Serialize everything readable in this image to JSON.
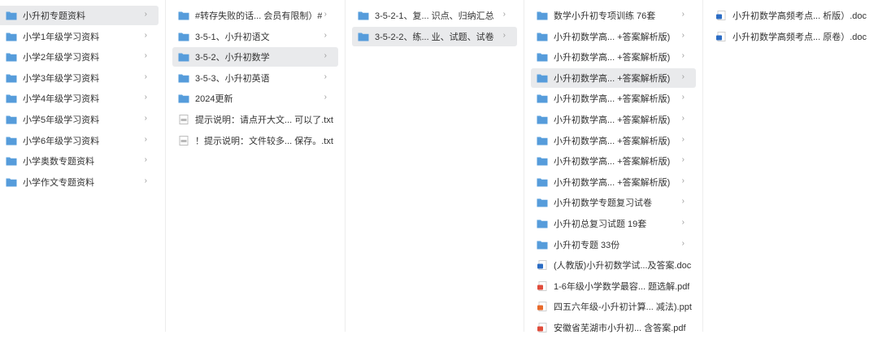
{
  "columns": [
    {
      "items": [
        {
          "type": "folder",
          "label": "小升初专题资料",
          "selected": true
        },
        {
          "type": "folder",
          "label": "小学1年级学习资料"
        },
        {
          "type": "folder",
          "label": "小学2年级学习资料"
        },
        {
          "type": "folder",
          "label": "小学3年级学习资料"
        },
        {
          "type": "folder",
          "label": "小学4年级学习资料"
        },
        {
          "type": "folder",
          "label": "小学5年级学习资料"
        },
        {
          "type": "folder",
          "label": "小学6年级学习资料"
        },
        {
          "type": "folder",
          "label": "小学奥数专题资料"
        },
        {
          "type": "folder",
          "label": "小学作文专题资料"
        }
      ]
    },
    {
      "items": [
        {
          "type": "folder",
          "label": "#转存失败的话... 会员有限制）#"
        },
        {
          "type": "folder",
          "label": "3-5-1、小升初语文"
        },
        {
          "type": "folder",
          "label": "3-5-2、小升初数学",
          "selected": true
        },
        {
          "type": "folder",
          "label": "3-5-3、小升初英语"
        },
        {
          "type": "folder",
          "label": "2024更新"
        },
        {
          "type": "txt",
          "label": "提示说明：请点开大文... 可以了.txt"
        },
        {
          "type": "txt",
          "label": "！提示说明：文件较多... 保存。.txt"
        }
      ]
    },
    {
      "items": [
        {
          "type": "folder",
          "label": "3-5-2-1、复... 识点、归纳汇总"
        },
        {
          "type": "folder",
          "label": "3-5-2-2、练... 业、试题、试卷",
          "selected": true
        }
      ]
    },
    {
      "items": [
        {
          "type": "folder",
          "label": "数学小升初专项训练 76套"
        },
        {
          "type": "folder",
          "label": "小升初数学高... +答案解析版)"
        },
        {
          "type": "folder",
          "label": "小升初数学高... +答案解析版)"
        },
        {
          "type": "folder",
          "label": "小升初数学高... +答案解析版)",
          "selected": true
        },
        {
          "type": "folder",
          "label": "小升初数学高... +答案解析版)"
        },
        {
          "type": "folder",
          "label": "小升初数学高... +答案解析版)"
        },
        {
          "type": "folder",
          "label": "小升初数学高... +答案解析版)"
        },
        {
          "type": "folder",
          "label": "小升初数学高... +答案解析版)"
        },
        {
          "type": "folder",
          "label": "小升初数学高... +答案解析版)"
        },
        {
          "type": "folder",
          "label": "小升初数学专题复习试卷"
        },
        {
          "type": "folder",
          "label": "小升初总复习试题 19套"
        },
        {
          "type": "folder",
          "label": "小升初专题 33份"
        },
        {
          "type": "doc",
          "label": "(人教版)小升初数学试...及答案.doc"
        },
        {
          "type": "pdf",
          "label": "1-6年级小学数学最容... 题选解.pdf"
        },
        {
          "type": "ppt",
          "label": "四五六年级-小升初计算... 减法).ppt"
        },
        {
          "type": "pdf",
          "label": "安徽省芜湖市小升初... 含答案.pdf"
        }
      ]
    },
    {
      "items": [
        {
          "type": "doc",
          "label": "小升初数学高频考点... 析版）.doc"
        },
        {
          "type": "doc",
          "label": "小升初数学高频考点... 原卷）.doc"
        }
      ]
    }
  ],
  "colors": {
    "folder": "#5aa0de",
    "folder_tab": "#4a90d4",
    "selected_bg": "#e9eaec",
    "doc": "#2b6cc4",
    "pdf": "#e04b3a",
    "ppt": "#e8692a",
    "txt": "#8a8a8a"
  },
  "icons": {
    "folder": "folder-icon",
    "txt": "txt-file-icon",
    "doc": "word-doc-icon",
    "pdf": "pdf-file-icon",
    "ppt": "ppt-file-icon",
    "chevron": "chevron-right-icon"
  },
  "chevron": "›"
}
